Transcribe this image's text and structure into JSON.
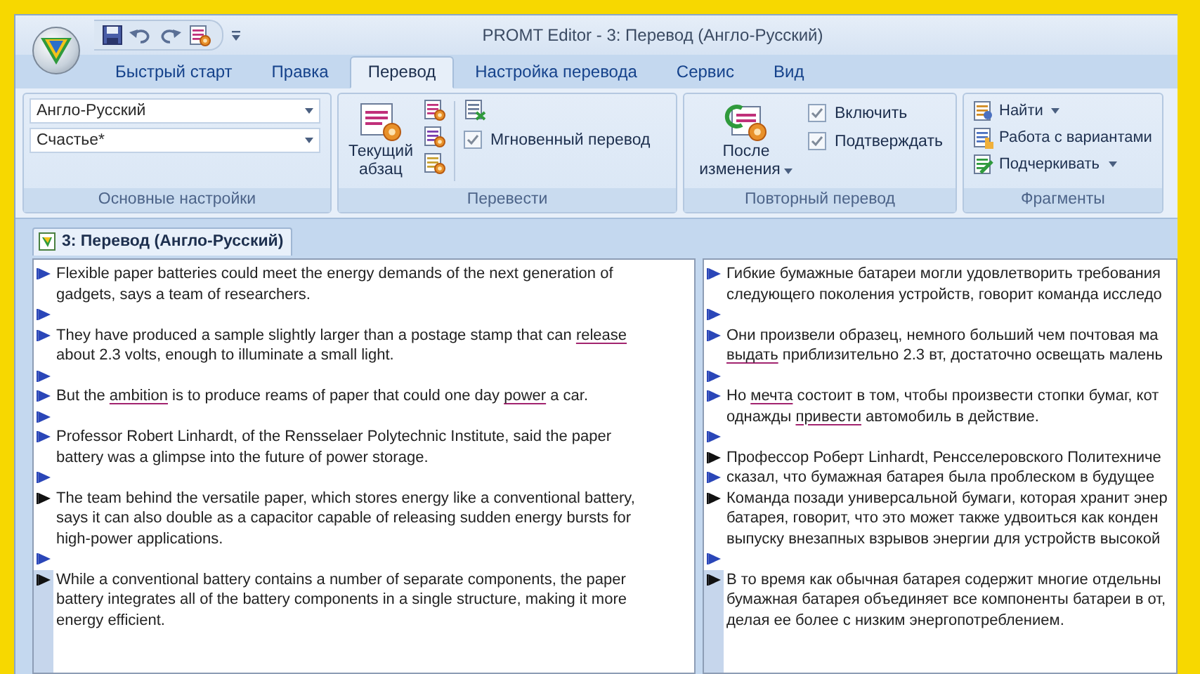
{
  "window": {
    "title": "PROMT Editor - 3: Перевод (Англо-Русский)"
  },
  "tabs": [
    {
      "label": "Быстрый старт",
      "selected": false
    },
    {
      "label": "Правка",
      "selected": false
    },
    {
      "label": "Перевод",
      "selected": true
    },
    {
      "label": "Настройка перевода",
      "selected": false
    },
    {
      "label": "Сервис",
      "selected": false
    },
    {
      "label": "Вид",
      "selected": false
    }
  ],
  "ribbon": {
    "settings": {
      "label": "Основные настройки",
      "direction": "Англо-Русский",
      "dictionary": "Счастье*"
    },
    "translate": {
      "label": "Перевести",
      "big_button": "Текущий абзац",
      "instant": {
        "label": "Мгновенный перевод",
        "checked": true
      }
    },
    "retranslate": {
      "label": "Повторный перевод",
      "big_button": "После изменения",
      "options": [
        {
          "label": "Включить",
          "checked": true
        },
        {
          "label": "Подтверждать",
          "checked": true
        }
      ]
    },
    "fragments": {
      "label": "Фрагменты",
      "items": [
        {
          "label": "Найти",
          "dropdown": true
        },
        {
          "label": "Работа с вариантами",
          "dropdown": false
        },
        {
          "label": "Подчеркивать",
          "dropdown": true
        }
      ]
    }
  },
  "document_tab": {
    "title": "3: Перевод (Англо-Русский)"
  },
  "source": [
    {
      "color": "#2a46b8",
      "selected": false,
      "lines": [
        [
          {
            "text": "Flexible paper batteries could meet the energy demands of the next generation of"
          }
        ],
        [
          {
            "text": "gadgets, says a team of researchers."
          }
        ]
      ]
    },
    {
      "color": "#2a46b8",
      "selected": false
    },
    {
      "color": "#2a46b8",
      "selected": false,
      "lines": [
        [
          {
            "text": "They have produced a sample slightly larger than a postage stamp that can "
          },
          {
            "text": "release",
            "underlined": true
          }
        ],
        [
          {
            "text": "about 2.3 volts, enough to illuminate a small light."
          }
        ]
      ]
    },
    {
      "color": "#2a46b8",
      "selected": false
    },
    {
      "color": "#2a46b8",
      "selected": false,
      "lines": [
        [
          {
            "text": "But the "
          },
          {
            "text": "ambition",
            "underlined": true
          },
          {
            "text": " is to produce reams of paper that could one day "
          },
          {
            "text": "power",
            "underlined": true
          },
          {
            "text": " a car."
          }
        ]
      ]
    },
    {
      "color": "#2a46b8",
      "selected": false
    },
    {
      "color": "#2a46b8",
      "selected": false,
      "lines": [
        [
          {
            "text": "Professor Robert Linhardt, of the Rensselaer Polytechnic Institute, said the paper"
          }
        ],
        [
          {
            "text": "battery was a glimpse into the future of power storage."
          }
        ]
      ]
    },
    {
      "color": "#2a46b8",
      "selected": false
    },
    {
      "color": "#111111",
      "selected": false,
      "lines": [
        [
          {
            "text": "The team behind the versatile paper, which stores energy like a conventional battery,"
          }
        ],
        [
          {
            "text": "says it can also double as a capacitor capable of releasing sudden energy bursts for"
          }
        ],
        [
          {
            "text": "high-power applications."
          }
        ]
      ]
    },
    {
      "color": "#2a46b8",
      "selected": false
    },
    {
      "color": "#111111",
      "selected": true,
      "lines": [
        [
          {
            "text": "While a conventional battery contains a number of separate components, the paper"
          }
        ],
        [
          {
            "text": "battery integrates all of the battery components in a single structure, making it more"
          }
        ],
        [
          {
            "text": "energy efficient."
          }
        ]
      ]
    }
  ],
  "target": [
    {
      "color": "#2a46b8",
      "selected": false,
      "lines": [
        [
          {
            "text": "Гибкие бумажные батареи могли удовлетворить требования"
          }
        ],
        [
          {
            "text": "следующего поколения устройств, говорит команда исследо"
          }
        ]
      ]
    },
    {
      "color": "#2a46b8",
      "selected": false
    },
    {
      "color": "#2a46b8",
      "selected": false,
      "lines": [
        [
          {
            "text": "Они произвели образец, немного больший чем почтовая ма"
          }
        ],
        [
          {
            "text": "выдать",
            "underlined": true
          },
          {
            "text": " приблизительно 2.3 вт, достаточно освещать малень"
          }
        ]
      ]
    },
    {
      "color": "#2a46b8",
      "selected": false
    },
    {
      "color": "#2a46b8",
      "selected": false,
      "lines": [
        [
          {
            "text": "Но "
          },
          {
            "text": "мечта",
            "underlined": true
          },
          {
            "text": " состоит в том, чтобы произвести стопки бумаг, кот"
          }
        ],
        [
          {
            "text": "однажды "
          },
          {
            "text": "привести",
            "underlined": true
          },
          {
            "text": " автомобиль в действие."
          }
        ]
      ]
    },
    {
      "color": "#2a46b8",
      "selected": false
    },
    {
      "color": "#111111",
      "selected": false,
      "lines": [
        [
          {
            "text": "Профессор Роберт Linhardt, Ренсселеровского Политехниче"
          }
        ]
      ]
    },
    {
      "color": "#2a46b8",
      "selected": false,
      "lines": [
        [
          {
            "text": "сказал, что бумажная батарея была проблеском в будущее"
          }
        ]
      ]
    },
    {
      "color": "#111111",
      "selected": false,
      "lines": [
        [
          {
            "text": "Команда позади универсальной бумаги, которая хранит энер"
          }
        ],
        [
          {
            "text": "батарея, говорит, что это может также удвоиться как конден"
          }
        ],
        [
          {
            "text": "выпуску внезапных взрывов энергии для устройств высокой"
          }
        ]
      ]
    },
    {
      "color": "#2a46b8",
      "selected": false
    },
    {
      "color": "#111111",
      "selected": true,
      "lines": [
        [
          {
            "text": "В то время как обычная батарея содержит многие отдельны"
          }
        ],
        [
          {
            "text": "бумажная батарея объединяет все компоненты батареи в от,"
          }
        ],
        [
          {
            "text": "делая ее более с низким энергопотреблением."
          }
        ]
      ]
    }
  ]
}
